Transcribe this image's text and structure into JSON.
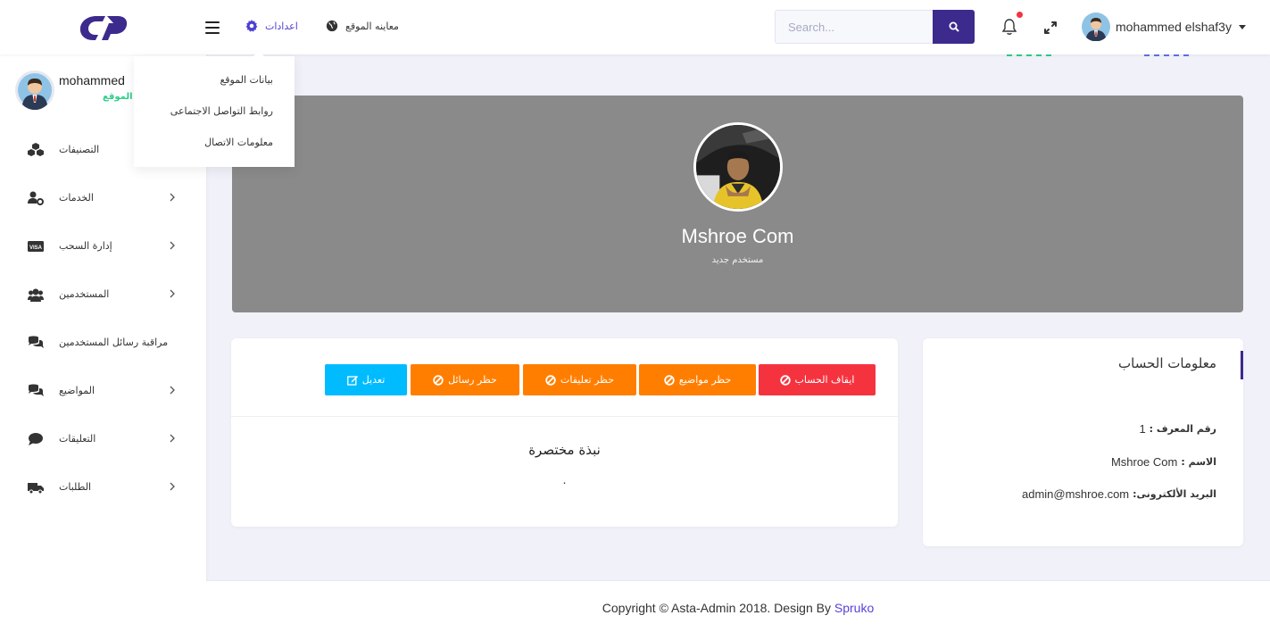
{
  "header": {
    "settings_label": "اعدادات",
    "preview_label": "معاينه الموقع",
    "search_placeholder": "Search...",
    "user_name": "mohammed elshaf3y"
  },
  "colors": {
    "brand": "#3d2a8d",
    "link": "#4c3fd1",
    "danger": "#f5333f",
    "warning": "#ff7e00",
    "info": "#00bcff",
    "success": "#2dce89"
  },
  "sidebar": {
    "user_name": "mohammed",
    "user_role": "ك الموقع",
    "items": [
      {
        "label": "التصنيفات",
        "icon": "cubes-icon",
        "has_children": false
      },
      {
        "label": "الخدمات",
        "icon": "user-cog-icon",
        "has_children": true
      },
      {
        "label": "إدارة السحب",
        "icon": "visa-card-icon",
        "has_children": true
      },
      {
        "label": "المستخدمين",
        "icon": "users-icon",
        "has_children": true
      },
      {
        "label": "مراقبة رسائل المستخدمين",
        "icon": "comments-icon",
        "has_children": false
      },
      {
        "label": "المواضيع",
        "icon": "comments-icon",
        "has_children": true
      },
      {
        "label": "التعليقات",
        "icon": "comment-icon",
        "has_children": true
      },
      {
        "label": "الطلبات",
        "icon": "truck-icon",
        "has_children": true
      }
    ]
  },
  "dropdown": {
    "items": [
      "بيانات الموقع",
      "روابط التواصل الاجتماعى",
      "معلومات الاتصال"
    ]
  },
  "profile": {
    "name": "Mshroe Com",
    "role": "مستخدم جديد"
  },
  "actions": {
    "suspend": "ايقاف الحساب",
    "ban_topics": "حظر مواضيع",
    "ban_comments": "حظر تعليقات",
    "ban_messages": "حظر رسائل",
    "edit": "تعديل"
  },
  "bio": {
    "title": "نبذة مختصرة",
    "text": "."
  },
  "account_info": {
    "title": "معلومات الحساب",
    "id_label": "رقم المعرف :",
    "id_value": "1",
    "name_label": "الاسم :",
    "name_value": "Mshroe Com",
    "email_label": "البريد الألكترونى:",
    "email_value": "admin@mshroe.com"
  },
  "footer": {
    "text": "Copyright © Asta-Admin 2018. Design By",
    "link": "Spruko"
  }
}
